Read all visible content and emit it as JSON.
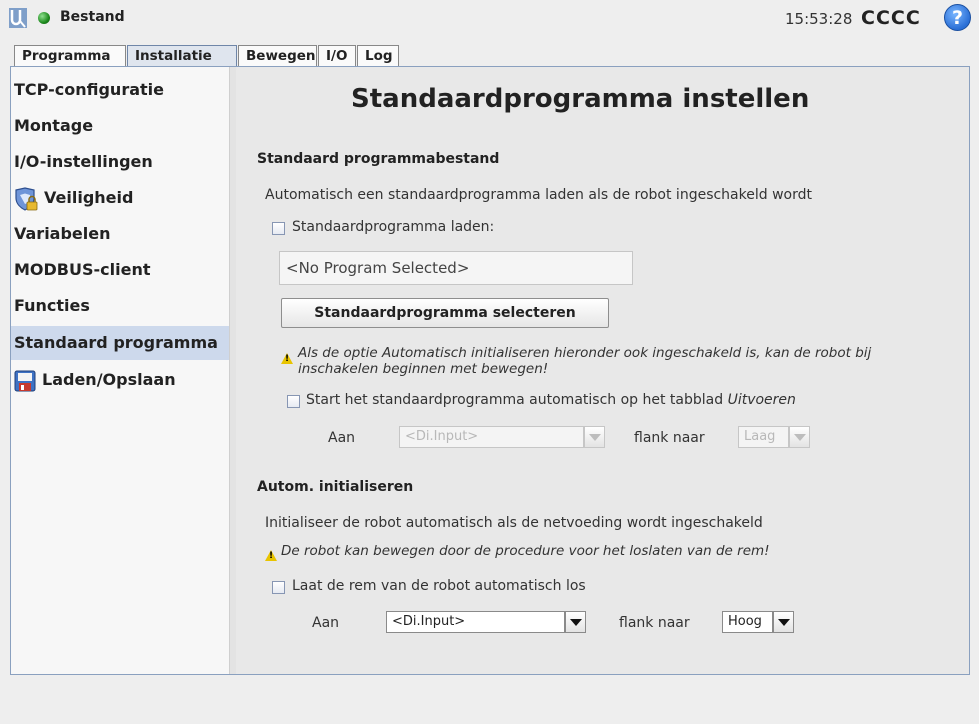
{
  "header": {
    "file_name": "Bestand",
    "clock": "15:53:28",
    "robot_name": "CCCC",
    "help_glyph": "?"
  },
  "tabs": [
    {
      "label": "Programma",
      "active": false
    },
    {
      "label": "Installatie",
      "active": true
    },
    {
      "label": "Bewegen",
      "active": false
    },
    {
      "label": "I/O",
      "active": false
    },
    {
      "label": "Log",
      "active": false
    }
  ],
  "sidebar": {
    "items": [
      {
        "label": "TCP-configuratie",
        "icon": null
      },
      {
        "label": "Montage",
        "icon": null
      },
      {
        "label": "I/O-instellingen",
        "icon": null
      },
      {
        "label": "Veiligheid",
        "icon": "shield-lock-icon"
      },
      {
        "label": "Variabelen",
        "icon": null
      },
      {
        "label": "MODBUS-client",
        "icon": null
      },
      {
        "label": "Functies",
        "icon": null
      },
      {
        "label": "Standaard programma",
        "icon": null,
        "selected": true
      },
      {
        "label": "Laden/Opslaan",
        "icon": "floppy-disk-icon"
      }
    ]
  },
  "main": {
    "title": "Standaardprogramma instellen",
    "default_file": {
      "heading": "Standaard programmabestand",
      "description": "Automatisch een standaardprogramma laden als de robot ingeschakeld wordt",
      "load_checkbox_label": "Standaardprogramma laden:",
      "load_checked": false,
      "program_field_value": "<No Program Selected>",
      "select_button_label": "Standaardprogramma selecteren",
      "warning_text_line1": "Als de optie Automatisch initialiseren hieronder ook ingeschakeld is, kan de robot bij",
      "warning_text_line2": "inschakelen beginnen met bewegen!",
      "autostart_checkbox_label": "Start het standaardprogramma automatisch op het tabblad ",
      "autostart_tab_name": "Uitvoeren",
      "autostart_checked": false,
      "on_label": "Aan",
      "input_value": "<Di.Input>",
      "edge_label": "flank naar",
      "edge_value": "Laag"
    },
    "auto_init": {
      "heading": "Autom. initialiseren",
      "description": "Initialiseer de robot automatisch als de netvoeding wordt ingeschakeld",
      "warning_text": "De robot kan bewegen door de procedure voor het loslaten van de rem!",
      "release_checkbox_label": "Laat de rem van de robot automatisch los",
      "release_checked": false,
      "on_label": "Aan",
      "input_value": "<Di.Input>",
      "edge_label": "flank naar",
      "edge_value": "Hoog"
    }
  },
  "colors": {
    "selected_bg": "#cdd9ec",
    "status_green": "#1d8a1d",
    "warning_yellow": "#e8c400",
    "help_blue": "#2a6fd6"
  }
}
